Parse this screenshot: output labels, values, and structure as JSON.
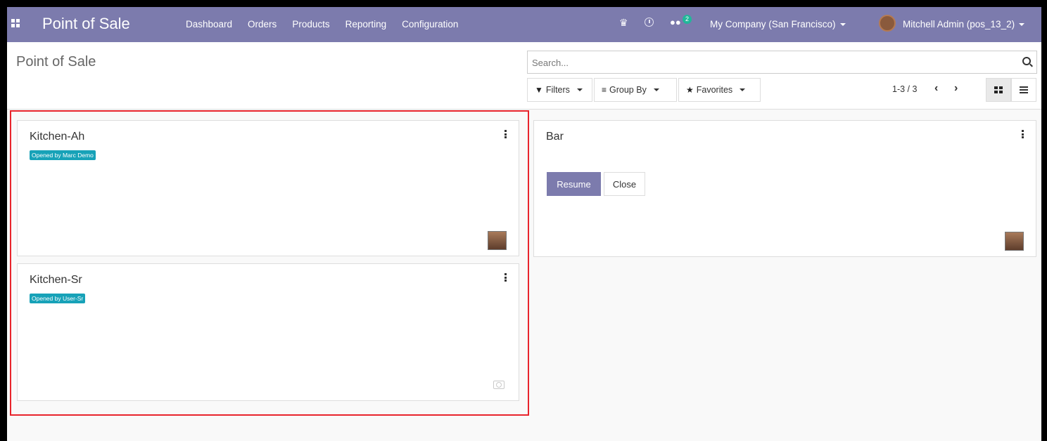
{
  "navbar": {
    "brand": "Point of Sale",
    "menu": [
      "Dashboard",
      "Orders",
      "Products",
      "Reporting",
      "Configuration"
    ],
    "chat_count": "2",
    "company": "My Company (San Francisco)",
    "user": "Mitchell Admin (pos_13_2)"
  },
  "control": {
    "title": "Point of Sale",
    "search_placeholder": "Search...",
    "filters_label": "Filters",
    "groupby_label": "Group By",
    "favorites_label": "Favorites",
    "pager": "1-3 / 3"
  },
  "cards": {
    "kitchen_ah": {
      "title": "Kitchen-Ah",
      "badge": "Opened by Marc Demo"
    },
    "kitchen_sr": {
      "title": "Kitchen-Sr",
      "badge": "Opened by User-Sr"
    },
    "bar": {
      "title": "Bar",
      "resume_label": "Resume",
      "close_label": "Close"
    }
  },
  "colors": {
    "navbar": "#7c7bad",
    "badge": "#17a2b8",
    "highlight": "#e8242c"
  }
}
